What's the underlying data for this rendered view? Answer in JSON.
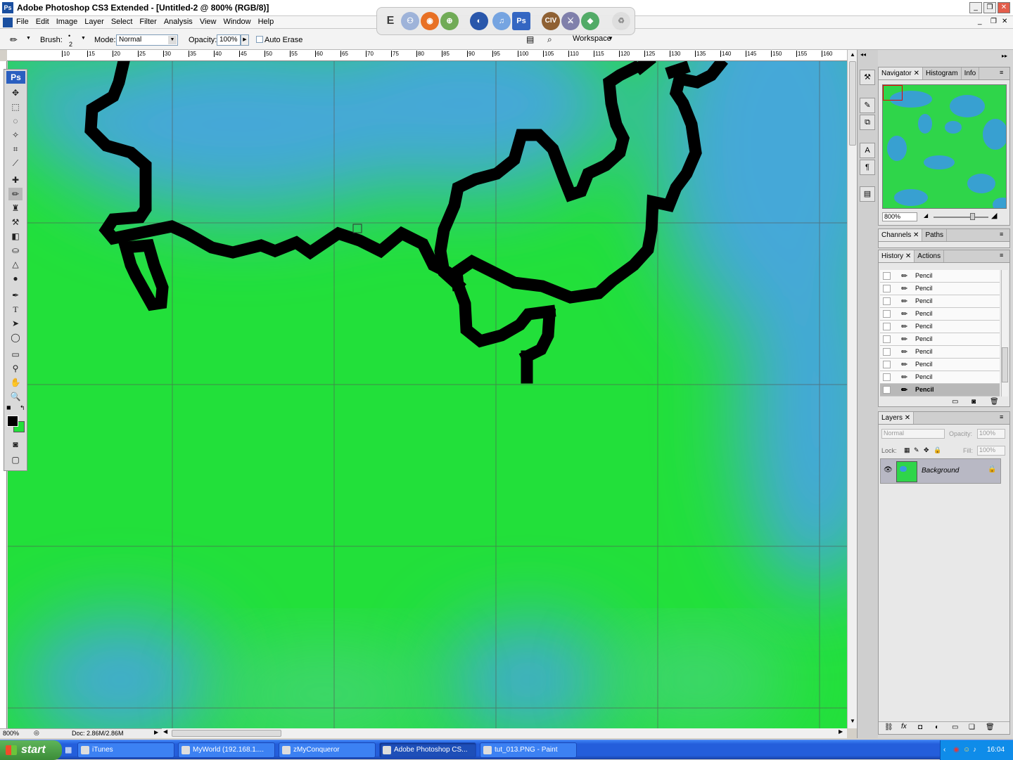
{
  "window": {
    "app_icon": "ps-icon",
    "title": "Adobe Photoshop CS3 Extended - [Untitled-2 @ 800% (RGB/8)]"
  },
  "menu": [
    "File",
    "Edit",
    "Image",
    "Layer",
    "Select",
    "Filter",
    "Analysis",
    "View",
    "Window",
    "Help"
  ],
  "options": {
    "brush_label": "Brush:",
    "brush_size": "2",
    "mode_label": "Mode:",
    "mode_value": "Normal",
    "opacity_label": "Opacity:",
    "opacity_value": "100%",
    "auto_erase_label": "Auto Erase",
    "workspace_label": "Workspace"
  },
  "ruler_labels": [
    "10",
    "15",
    "20",
    "25",
    "30",
    "35",
    "40",
    "45",
    "50",
    "55",
    "60",
    "65",
    "70",
    "75",
    "80",
    "85",
    "90",
    "95",
    "100",
    "105",
    "110",
    "115",
    "120",
    "125",
    "130",
    "135",
    "140",
    "145",
    "150",
    "155",
    "160"
  ],
  "toolbox": {
    "logo": "Ps"
  },
  "status": {
    "zoom": "800%",
    "doc": "Doc: 2.86M/2.86M"
  },
  "panels": {
    "navigator_tabs": [
      "Navigator",
      "Histogram",
      "Info"
    ],
    "navigator_zoom": "800%",
    "channels_tabs": [
      "Channels",
      "Paths"
    ],
    "history_tabs": [
      "History",
      "Actions"
    ],
    "history_items": [
      "Pencil",
      "Pencil",
      "Pencil",
      "Pencil",
      "Pencil",
      "Pencil",
      "Pencil",
      "Pencil",
      "Pencil",
      "Pencil"
    ],
    "layers_tab": "Layers",
    "layers_mode": "Normal",
    "layers_opacity_label": "Opacity:",
    "layers_opacity": "100%",
    "layers_lock_label": "Lock:",
    "layers_fill_label": "Fill:",
    "layers_fill": "100%",
    "layer_name": "Background"
  },
  "taskbar": {
    "start": "start",
    "tasks": [
      "iTunes",
      "MyWorld (192.168.1....",
      "zMyConqueror",
      "Adobe Photoshop CS...",
      "tut_013.PNG - Paint"
    ],
    "active_index": 3,
    "clock": "16:04"
  },
  "colors": {
    "canvas_green": "#22e03a",
    "canvas_blue": "#45a8d8",
    "stroke": "#000000",
    "taskbar": "#245edb"
  }
}
